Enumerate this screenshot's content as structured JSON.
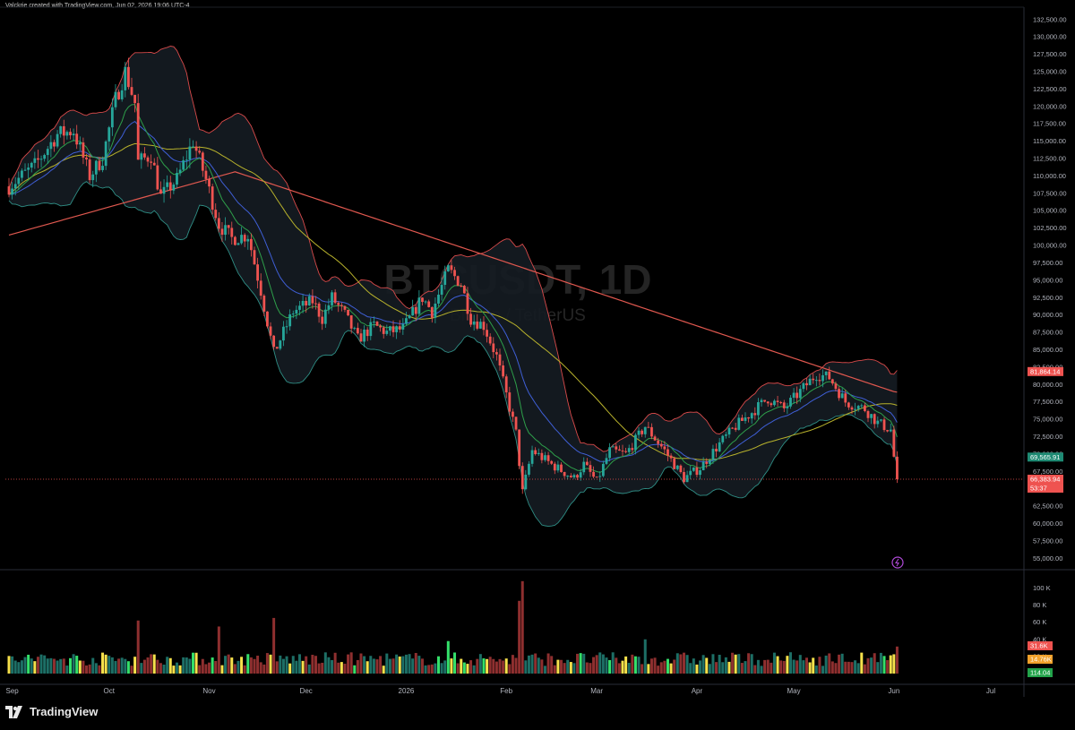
{
  "header": {
    "credit": "Valckrie created with TradingView.com, Jun 02, 2026 19:06 UTC-4"
  },
  "footer": {
    "brand": "TradingView"
  },
  "colors": {
    "background": "#000000",
    "candle_up": "#26a69a",
    "candle_down": "#ef5350",
    "bb_band": "#d84a4a",
    "bb_fill": "#151c22",
    "ema_fast": "#3f5fd6",
    "ema_green": "#2e9f4a",
    "ema_yellow": "#b8b22c",
    "ma_200": "#e0584f",
    "volume_yellow": "#f6e14b",
    "volume_bright_green": "#34e06a"
  },
  "chart_data": {
    "type": "candlestick",
    "symbol_watermark": "BTCUSDT, 1D",
    "watermark_subtitle": "Bitcoin / TetherUS",
    "x_axis": {
      "labels": [
        "Sep",
        "Oct",
        "Nov",
        "Dec",
        "2026",
        "Feb",
        "Mar",
        "Apr",
        "May",
        "Jun",
        "Jul"
      ],
      "label_dates": [
        "2025-09-01",
        "2025-10-01",
        "2025-11-01",
        "2025-12-01",
        "2026-01-01",
        "2026-02-01",
        "2026-03-01",
        "2026-04-01",
        "2026-05-01",
        "2026-06-01",
        "2026-07-01"
      ],
      "first_date": "2025-08-31",
      "last_date": "2026-06-02"
    },
    "y_axis": {
      "ticks": [
        "132,500.00",
        "130,000.00",
        "127,500.00",
        "125,000.00",
        "122,500.00",
        "120,000.00",
        "117,500.00",
        "115,000.00",
        "112,500.00",
        "110,000.00",
        "107,500.00",
        "105,000.00",
        "102,500.00",
        "100,000.00",
        "97,500.00",
        "95,000.00",
        "92,500.00",
        "90,000.00",
        "87,500.00",
        "85,000.00",
        "82,500.00",
        "80,000.00",
        "77,500.00",
        "75,000.00",
        "72,500.00",
        "70,000.00",
        "67,500.00",
        "65,000.00",
        "62,500.00",
        "60,000.00",
        "57,500.00",
        "55,000.00"
      ],
      "range": [
        53500,
        133500
      ]
    },
    "price_labels": [
      {
        "text": "81,864.14",
        "value": 81864.14,
        "color": "#ef5350"
      },
      {
        "text": "69,565.91",
        "value": 69565.91,
        "color": "#1e8a73"
      },
      {
        "text": "66,383.94",
        "value": 66383.94,
        "color": "#ef5350"
      },
      {
        "text": "53:37",
        "value": 65700,
        "color": "#ef5350"
      }
    ],
    "current_price": 66383.94,
    "price_path": [
      [
        "2025-08-31",
        108500
      ],
      [
        "2025-09-08",
        111500
      ],
      [
        "2025-09-15",
        116000
      ],
      [
        "2025-09-20",
        116500
      ],
      [
        "2025-09-25",
        110000
      ],
      [
        "2025-09-29",
        112500
      ],
      [
        "2025-10-03",
        121000
      ],
      [
        "2025-10-06",
        125000
      ],
      [
        "2025-10-09",
        120500
      ],
      [
        "2025-10-10",
        112000
      ],
      [
        "2025-10-14",
        113000
      ],
      [
        "2025-10-17",
        107000
      ],
      [
        "2025-10-22",
        109500
      ],
      [
        "2025-10-27",
        115000
      ],
      [
        "2025-10-31",
        109500
      ],
      [
        "2025-11-04",
        103000
      ],
      [
        "2025-11-08",
        101000
      ],
      [
        "2025-11-13",
        101500
      ],
      [
        "2025-11-17",
        93500
      ],
      [
        "2025-11-21",
        84500
      ],
      [
        "2025-11-27",
        90500
      ],
      [
        "2025-12-03",
        92000
      ],
      [
        "2025-12-06",
        89500
      ],
      [
        "2025-12-09",
        92500
      ],
      [
        "2025-12-13",
        90000
      ],
      [
        "2025-12-17",
        86500
      ],
      [
        "2025-12-22",
        88500
      ],
      [
        "2025-12-26",
        87500
      ],
      [
        "2025-12-31",
        88000
      ],
      [
        "2026-01-06",
        92500
      ],
      [
        "2026-01-09",
        90500
      ],
      [
        "2026-01-14",
        96500
      ],
      [
        "2026-01-18",
        94500
      ],
      [
        "2026-01-21",
        89500
      ],
      [
        "2026-01-25",
        88500
      ],
      [
        "2026-01-29",
        84000
      ],
      [
        "2026-02-01",
        78500
      ],
      [
        "2026-02-04",
        73000
      ],
      [
        "2026-02-06",
        64500
      ],
      [
        "2026-02-09",
        70500
      ],
      [
        "2026-02-15",
        68500
      ],
      [
        "2026-02-22",
        66500
      ],
      [
        "2026-02-25",
        68500
      ],
      [
        "2026-03-01",
        66000
      ],
      [
        "2026-03-05",
        70500
      ],
      [
        "2026-03-10",
        70000
      ],
      [
        "2026-03-16",
        74000
      ],
      [
        "2026-03-22",
        70500
      ],
      [
        "2026-03-28",
        66500
      ],
      [
        "2026-04-02",
        68000
      ],
      [
        "2026-04-08",
        71500
      ],
      [
        "2026-04-13",
        74000
      ],
      [
        "2026-04-18",
        76000
      ],
      [
        "2026-04-23",
        78000
      ],
      [
        "2026-04-28",
        76500
      ],
      [
        "2026-05-03",
        79000
      ],
      [
        "2026-05-08",
        81500
      ],
      [
        "2026-05-12",
        81000
      ],
      [
        "2026-05-17",
        77500
      ],
      [
        "2026-05-23",
        76500
      ],
      [
        "2026-05-27",
        74500
      ],
      [
        "2026-05-31",
        73500
      ],
      [
        "2026-06-01",
        69600
      ],
      [
        "2026-06-02",
        66383.94
      ]
    ],
    "volume": {
      "axis_ticks": [
        "100 K",
        "80 K",
        "60 K",
        "40 K",
        "20 K"
      ],
      "range": [
        0,
        112000
      ],
      "labels": [
        {
          "text": "31.6K",
          "value": 31600,
          "color": "#ef5350"
        },
        {
          "text": "14.76K",
          "value": 14760,
          "color": "#f0a02a"
        },
        {
          "text": "114.04",
          "value": 0,
          "color": "#22a34a"
        }
      ],
      "spikes": [
        [
          "2025-10-10",
          62000
        ],
        [
          "2025-11-04",
          55000
        ],
        [
          "2025-11-21",
          65000
        ],
        [
          "2026-01-14",
          38000
        ],
        [
          "2026-02-06",
          108000
        ],
        [
          "2026-02-05",
          85000
        ],
        [
          "2026-03-16",
          40000
        ],
        [
          "2026-06-02",
          31600
        ]
      ]
    }
  }
}
